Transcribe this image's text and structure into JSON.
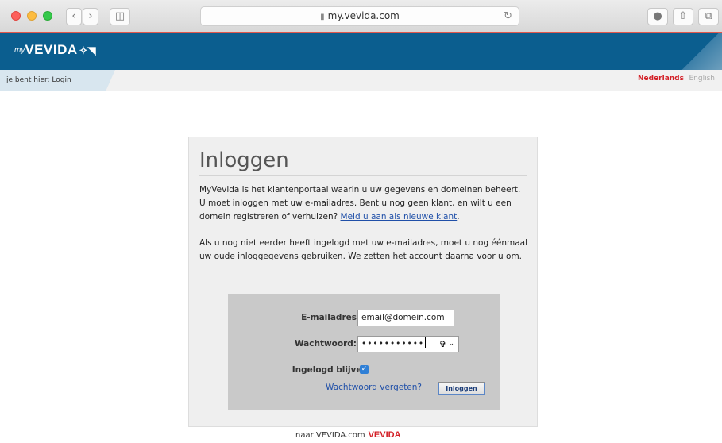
{
  "browser": {
    "url": "my.vevida.com",
    "back_icon": "chevron-left-icon",
    "forward_icon": "chevron-right-icon"
  },
  "header": {
    "logo_prefix": "my",
    "logo_text": "VEVIDA",
    "logo_mark": "✧◥"
  },
  "breadcrumb": {
    "text": "je bent hier:  Login"
  },
  "languages": {
    "active": "Nederlands",
    "other": "English"
  },
  "login": {
    "title": "Inloggen",
    "paragraph1_text": "MyVevida is het klantenportaal waarin u uw gegevens en domeinen beheert. U moet inloggen met uw e-mailadres. Bent u nog geen klant, en wilt u een domein registreren of verhuizen? ",
    "paragraph1_link": "Meld u aan als nieuwe klant",
    "paragraph1_end": ".",
    "paragraph2": "Als u nog niet eerder heeft ingelogd met uw e-mailadres, moet u nog éénmaal uw oude inloggegevens gebruiken. We zetten het account daarna voor u om.",
    "email_label": "E-mailadres",
    "email_value": "email@domein.com",
    "password_label": "Wachtwoord:",
    "password_value": "•••••••••••",
    "remember_label": "Ingelogd blijven",
    "remember_checked": true,
    "forgot_link": "Wachtwoord vergeten?",
    "submit_label": "Inloggen"
  },
  "footer": {
    "text": "naar VEVIDA.com",
    "brand": "VEVIDA"
  },
  "colors": {
    "header_blue": "#0b5e8f",
    "brand_red": "#d31f26",
    "link_blue": "#1f4fa8"
  }
}
